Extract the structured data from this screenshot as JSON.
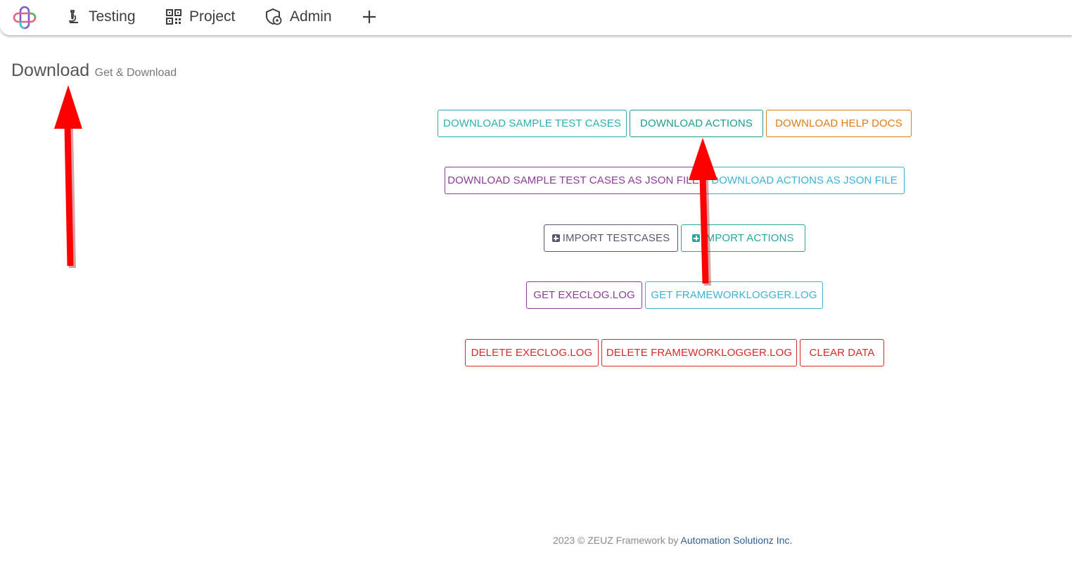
{
  "nav": {
    "items": [
      {
        "label": "Testing",
        "icon": "microscope-icon"
      },
      {
        "label": "Project",
        "icon": "qr-grid-icon"
      },
      {
        "label": "Admin",
        "icon": "shield-gear-icon"
      }
    ],
    "plus": "+"
  },
  "page": {
    "title": "Download",
    "subtitle": "Get & Download"
  },
  "buttons": {
    "download_sample_test_cases": "DOWNLOAD SAMPLE TEST CASES",
    "download_actions": "DOWNLOAD ACTIONS",
    "download_help_docs": "DOWNLOAD HELP DOCS",
    "download_sample_json": "DOWNLOAD SAMPLE TEST CASES AS JSON FILE",
    "download_actions_json": "DOWNLOAD ACTIONS AS JSON FILE",
    "import_testcases": "IMPORT TESTCASES",
    "import_actions": "IMPORT ACTIONS",
    "get_execlog": "GET EXECLOG.LOG",
    "get_frameworklogger": "GET FRAMEWORKLOGGER.LOG",
    "delete_execlog": "DELETE EXECLOG.LOG",
    "delete_frameworklogger": "DELETE FRAMEWORKLOGGER.LOG",
    "clear_data": "CLEAR DATA"
  },
  "footer": {
    "text": "2023 © ZEUZ Framework by",
    "link": "Automation Solutionz Inc."
  },
  "colors": {
    "teal": "#2ab0b0",
    "green": "#1f9a8c",
    "orange": "#e07b14",
    "purple": "#8a3c96",
    "cyan": "#3bb2d9",
    "slate": "#5c5470",
    "red": "#d42a2a",
    "annotation_arrow": "#ff0000"
  }
}
